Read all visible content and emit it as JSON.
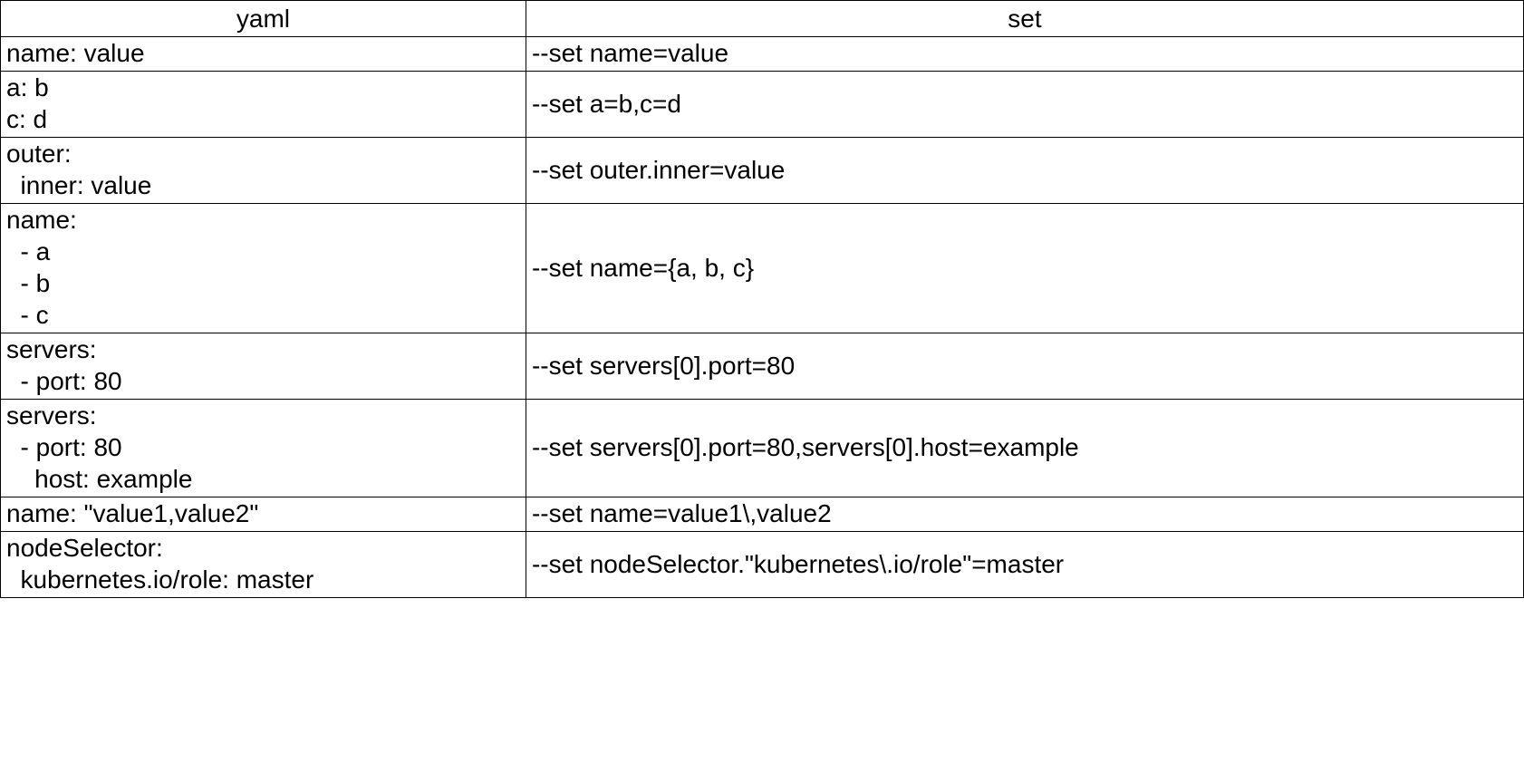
{
  "headers": {
    "yaml": "yaml",
    "set": "set"
  },
  "rows": [
    {
      "yaml": "name: value",
      "set": "--set name=value"
    },
    {
      "yaml": "a: b\nc: d",
      "set": "--set a=b,c=d"
    },
    {
      "yaml": "outer:\n  inner: value",
      "set": "--set outer.inner=value"
    },
    {
      "yaml": "name:\n  - a\n  - b\n  - c",
      "set": "--set name={a, b, c}"
    },
    {
      "yaml": "servers:\n  - port: 80",
      "set": "--set servers[0].port=80"
    },
    {
      "yaml": "servers:\n  - port: 80\n    host: example",
      "set": "--set servers[0].port=80,servers[0].host=example"
    },
    {
      "yaml": "name: \"value1,value2\"",
      "set": "--set name=value1\\,value2"
    },
    {
      "yaml": "nodeSelector:\n  kubernetes.io/role: master",
      "set": "--set nodeSelector.\"kubernetes\\.io/role\"=master"
    }
  ]
}
